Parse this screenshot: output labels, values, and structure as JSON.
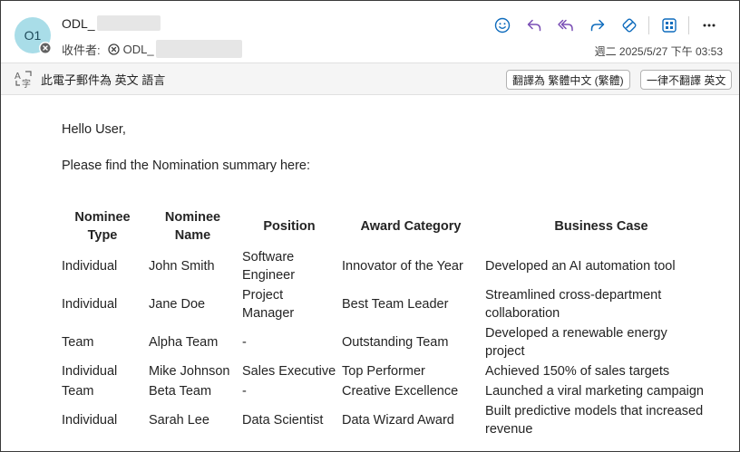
{
  "header": {
    "avatar_initials": "O1",
    "sender_name": "ODL_",
    "recipients_label": "收件者:",
    "recipient_name": "ODL_",
    "date": "週二 2025/5/27 下午 03:53",
    "toolbar": [
      {
        "name": "react-button",
        "icon": "smiley-icon"
      },
      {
        "name": "reply-button",
        "icon": "reply-icon"
      },
      {
        "name": "reply-all-button",
        "icon": "reply-all-icon"
      },
      {
        "name": "forward-button",
        "icon": "forward-icon"
      },
      {
        "name": "loop-button",
        "icon": "loop-icon"
      },
      {
        "name": "apps-button",
        "icon": "apps-icon"
      },
      {
        "name": "more-button",
        "icon": "more-icon"
      }
    ]
  },
  "translate_bar": {
    "icon": "translate-icon",
    "message": "此電子郵件為 英文 語言",
    "translate_button": "翻譯為 繁體中文 (繁體)",
    "never_translate_button": "一律不翻譯 英文"
  },
  "email": {
    "greeting": "Hello User,",
    "intro": "Please find the Nomination summary here:",
    "table": {
      "headers": [
        [
          "Nominee",
          "Type"
        ],
        [
          "Nominee",
          "Name"
        ],
        [
          "Position"
        ],
        [
          "Award Category"
        ],
        [
          "Business Case"
        ]
      ],
      "rows": [
        {
          "type": "Individual",
          "name": "John Smith",
          "position": [
            "Software",
            "Engineer"
          ],
          "category": "Innovator of the Year",
          "case": [
            "Developed an AI automation tool"
          ]
        },
        {
          "type": "Individual",
          "name": "Jane Doe",
          "position": [
            "Project",
            "Manager"
          ],
          "category": "Best Team Leader",
          "case": [
            "Streamlined cross-department",
            "collaboration"
          ]
        },
        {
          "type": "Team",
          "name": "Alpha Team",
          "position": [
            "-"
          ],
          "category": "Outstanding Team",
          "case": [
            "Developed a renewable energy",
            "project"
          ]
        },
        {
          "type": "Individual",
          "name": "Mike Johnson",
          "position": [
            "Sales Executive"
          ],
          "category": "Top Performer",
          "case": [
            "Achieved 150% of sales targets"
          ]
        },
        {
          "type": "Team",
          "name": "Beta Team",
          "position": [
            "-"
          ],
          "category": "Creative Excellence",
          "case": [
            "Launched a viral marketing campaign"
          ]
        },
        {
          "type": "Individual",
          "name": "Sarah Lee",
          "position": [
            "Data Scientist"
          ],
          "category": "Data Wizard Award",
          "case": [
            "Built predictive models that increased",
            "revenue"
          ]
        }
      ]
    }
  },
  "colors": {
    "accent": "#0f6cbd",
    "avatar_bg": "#a9dde8",
    "translate_bar_bg": "#f5f5f5"
  }
}
